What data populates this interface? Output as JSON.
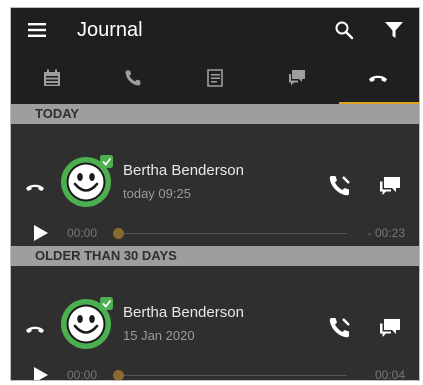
{
  "header": {
    "title": "Journal",
    "icons": [
      "menu-icon",
      "search-icon",
      "filter-icon"
    ]
  },
  "tabs": [
    {
      "name": "calendar",
      "icon": "calendar-icon",
      "active": false
    },
    {
      "name": "calls",
      "icon": "phone-icon",
      "active": false
    },
    {
      "name": "voicemail",
      "icon": "voicemail-list-icon",
      "active": false
    },
    {
      "name": "chat",
      "icon": "chat-icon",
      "active": false
    },
    {
      "name": "recordings",
      "icon": "hangup-icon",
      "active": true
    }
  ],
  "sections": [
    {
      "label": "TODAY",
      "entries": [
        {
          "name": "Bertha Benderson",
          "time": "today 09:25",
          "position": "00:00",
          "duration": "- 00:23"
        }
      ]
    },
    {
      "label": "OLDER THAN 30 DAYS",
      "entries": [
        {
          "name": "Bertha Benderson",
          "time": "15 Jan 2020",
          "position": "00:00",
          "duration": "00:04"
        }
      ]
    }
  ],
  "colors": {
    "background": "#2f2f2f",
    "bar": "#1f1f1f",
    "accent": "#e0a020",
    "section": "#9e9e9e",
    "avatar_green": "#4caf50"
  }
}
